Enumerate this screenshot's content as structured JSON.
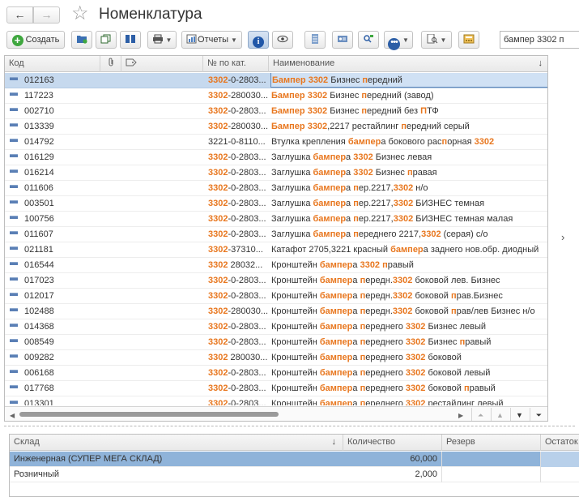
{
  "window": {
    "title": "Номенклатура",
    "nav_back": "←",
    "nav_forward": "→",
    "favorite_star": "☆"
  },
  "toolbar": {
    "create_label": "Создать",
    "reports_label": "Отчеты",
    "search_value": "бампер 3302 п"
  },
  "grid": {
    "headers": {
      "code": "Код",
      "cat_no": "№ по кат.",
      "name": "Наименование",
      "sort_indicator": "↓"
    },
    "highlight_color": "#e8771f",
    "rows": [
      {
        "code": "012163",
        "cat": [
          "3302",
          "-0-2803..."
        ],
        "name": [
          [
            "Бампер 3302",
            true
          ],
          [
            " Бизнес ",
            false
          ],
          [
            "п",
            true
          ],
          [
            "ередний",
            false
          ]
        ],
        "selected": true
      },
      {
        "code": "117223",
        "cat": [
          "3302",
          "-280030..."
        ],
        "name": [
          [
            "Бампер 3302",
            true
          ],
          [
            " Бизнес ",
            false
          ],
          [
            "п",
            true
          ],
          [
            "ередний (завод)",
            false
          ]
        ]
      },
      {
        "code": "002710",
        "cat": [
          "3302",
          "-0-2803..."
        ],
        "name": [
          [
            "Бампер 3302",
            true
          ],
          [
            " Бизнес ",
            false
          ],
          [
            "п",
            true
          ],
          [
            "ередний без ",
            false
          ],
          [
            "П",
            true
          ],
          [
            "ТФ",
            false
          ]
        ]
      },
      {
        "code": "013339",
        "cat": [
          "3302",
          "-280030..."
        ],
        "name": [
          [
            "Бампер 3302",
            true
          ],
          [
            ",2217 рестайлинг ",
            false
          ],
          [
            "п",
            true
          ],
          [
            "ередний серый",
            false
          ]
        ]
      },
      {
        "code": "014792",
        "cat": [
          "",
          "3221-0-8110..."
        ],
        "name": [
          [
            "Втулка креп",
            false
          ],
          [
            "л",
            false
          ],
          [
            "ения ",
            false
          ],
          [
            "бампер",
            true
          ],
          [
            "а бокового рас",
            false
          ],
          [
            "п",
            true
          ],
          [
            "орная ",
            false
          ],
          [
            "3302",
            true
          ]
        ]
      },
      {
        "code": "016129",
        "cat": [
          "3302",
          "-0-2803..."
        ],
        "name": [
          [
            "Заглушка ",
            false
          ],
          [
            "бампер",
            true
          ],
          [
            "а ",
            false
          ],
          [
            "3302",
            true
          ],
          [
            " Бизнес левая",
            false
          ]
        ]
      },
      {
        "code": "016214",
        "cat": [
          "3302",
          "-0-2803..."
        ],
        "name": [
          [
            "Заглушка ",
            false
          ],
          [
            "бампер",
            true
          ],
          [
            "а ",
            false
          ],
          [
            "3302",
            true
          ],
          [
            " Бизнес ",
            false
          ],
          [
            "п",
            true
          ],
          [
            "равая",
            false
          ]
        ]
      },
      {
        "code": "011606",
        "cat": [
          "3302",
          "-0-2803..."
        ],
        "name": [
          [
            "Заглушка ",
            false
          ],
          [
            "бампер",
            true
          ],
          [
            "а ",
            false
          ],
          [
            "п",
            true
          ],
          [
            "ер.2217,",
            false
          ],
          [
            "3302",
            true
          ],
          [
            " н/о",
            false
          ]
        ]
      },
      {
        "code": "003501",
        "cat": [
          "3302",
          "-0-2803..."
        ],
        "name": [
          [
            "Заглушка ",
            false
          ],
          [
            "бампер",
            true
          ],
          [
            "а ",
            false
          ],
          [
            "п",
            true
          ],
          [
            "ер.2217,",
            false
          ],
          [
            "3302",
            true
          ],
          [
            " БИЗНЕС темная",
            false
          ]
        ]
      },
      {
        "code": "100756",
        "cat": [
          "3302",
          "-0-2803..."
        ],
        "name": [
          [
            "Заглушка ",
            false
          ],
          [
            "бампер",
            true
          ],
          [
            "а ",
            false
          ],
          [
            "п",
            true
          ],
          [
            "ер.2217,",
            false
          ],
          [
            "3302",
            true
          ],
          [
            " БИЗНЕС темная малая",
            false
          ]
        ]
      },
      {
        "code": "011607",
        "cat": [
          "3302",
          "-0-2803..."
        ],
        "name": [
          [
            "Заглушка ",
            false
          ],
          [
            "бампер",
            true
          ],
          [
            "а ",
            false
          ],
          [
            "п",
            true
          ],
          [
            "ереднего 2217,",
            false
          ],
          [
            "3302",
            true
          ],
          [
            " (серая) с/о",
            false
          ]
        ]
      },
      {
        "code": "021181",
        "cat": [
          "3302",
          "-37310..."
        ],
        "name": [
          [
            "Катафот 2705,3221 красный ",
            false
          ],
          [
            "бампер",
            true
          ],
          [
            "а заднего нов.обр. диодный",
            false
          ]
        ]
      },
      {
        "code": "016544",
        "cat": [
          "3302",
          " 28032..."
        ],
        "name": [
          [
            "Кронштейн ",
            false
          ],
          [
            "бампер",
            true
          ],
          [
            "а ",
            false
          ],
          [
            "3302",
            true
          ],
          [
            " ",
            false
          ],
          [
            "п",
            true
          ],
          [
            "равый",
            false
          ]
        ]
      },
      {
        "code": "017023",
        "cat": [
          "3302",
          "-0-2803..."
        ],
        "name": [
          [
            "Кронштейн ",
            false
          ],
          [
            "бампер",
            true
          ],
          [
            "а ",
            false
          ],
          [
            "п",
            true
          ],
          [
            "еред",
            false
          ],
          [
            "н",
            false
          ],
          [
            ".",
            false
          ],
          [
            "3302",
            true
          ],
          [
            " боковой лев. Бизнес",
            false
          ]
        ]
      },
      {
        "code": "012017",
        "cat": [
          "3302",
          "-0-2803..."
        ],
        "name": [
          [
            "Кронштейн ",
            false
          ],
          [
            "бампер",
            true
          ],
          [
            "а ",
            false
          ],
          [
            "п",
            true
          ],
          [
            "еред",
            false
          ],
          [
            "н",
            false
          ],
          [
            ".",
            false
          ],
          [
            "3302",
            true
          ],
          [
            " боковой ",
            false
          ],
          [
            "п",
            true
          ],
          [
            "рав.Бизнес",
            false
          ]
        ]
      },
      {
        "code": "102488",
        "cat": [
          "3302",
          "-280030..."
        ],
        "name": [
          [
            "Кронштейн ",
            false
          ],
          [
            "бампер",
            true
          ],
          [
            "а ",
            false
          ],
          [
            "п",
            true
          ],
          [
            "еред",
            false
          ],
          [
            "н",
            false
          ],
          [
            ".",
            false
          ],
          [
            "3302",
            true
          ],
          [
            " боковой ",
            false
          ],
          [
            "п",
            true
          ],
          [
            "рав/лев Бизнес н/о",
            false
          ]
        ]
      },
      {
        "code": "014368",
        "cat": [
          "3302",
          "-0-2803..."
        ],
        "name": [
          [
            "Кронштейн ",
            false
          ],
          [
            "бампер",
            true
          ],
          [
            "а ",
            false
          ],
          [
            "п",
            true
          ],
          [
            "ереднего ",
            false
          ],
          [
            "3302",
            true
          ],
          [
            " Бизнес левый",
            false
          ]
        ]
      },
      {
        "code": "008549",
        "cat": [
          "3302",
          "-0-2803..."
        ],
        "name": [
          [
            "Кронштейн ",
            false
          ],
          [
            "бампер",
            true
          ],
          [
            "а ",
            false
          ],
          [
            "п",
            true
          ],
          [
            "ереднего ",
            false
          ],
          [
            "3302",
            true
          ],
          [
            " Бизнес ",
            false
          ],
          [
            "п",
            true
          ],
          [
            "равый",
            false
          ]
        ]
      },
      {
        "code": "009282",
        "cat": [
          "3302",
          " 280030..."
        ],
        "name": [
          [
            "Кронштейн ",
            false
          ],
          [
            "бампер",
            true
          ],
          [
            "а ",
            false
          ],
          [
            "п",
            true
          ],
          [
            "ереднего ",
            false
          ],
          [
            "3302",
            true
          ],
          [
            " боковой",
            false
          ]
        ]
      },
      {
        "code": "006168",
        "cat": [
          "3302",
          "-0-2803..."
        ],
        "name": [
          [
            "Кронштейн ",
            false
          ],
          [
            "бампер",
            true
          ],
          [
            "а ",
            false
          ],
          [
            "п",
            true
          ],
          [
            "ереднего ",
            false
          ],
          [
            "3302",
            true
          ],
          [
            " боковой левый",
            false
          ]
        ]
      },
      {
        "code": "017768",
        "cat": [
          "3302",
          "-0-2803..."
        ],
        "name": [
          [
            "Кронштейн ",
            false
          ],
          [
            "бампер",
            true
          ],
          [
            "а ",
            false
          ],
          [
            "п",
            true
          ],
          [
            "ереднего ",
            false
          ],
          [
            "3302",
            true
          ],
          [
            " боковой ",
            false
          ],
          [
            "п",
            true
          ],
          [
            "равый",
            false
          ]
        ]
      },
      {
        "code": "013301",
        "cat": [
          "3302",
          "-0-2803..."
        ],
        "name": [
          [
            "Кронштейн ",
            false
          ],
          [
            "бампер",
            true
          ],
          [
            "а ",
            false
          ],
          [
            "п",
            true
          ],
          [
            "ереднего ",
            false
          ],
          [
            "3302",
            true
          ],
          [
            " рестайлинг левый",
            false
          ]
        ]
      }
    ]
  },
  "stock": {
    "headers": {
      "warehouse": "Склад",
      "sort_indicator": "↓",
      "quantity": "Количество",
      "reserve": "Резерв",
      "remainder": "Остаток"
    },
    "rows": [
      {
        "warehouse": "Инженерная (СУПЕР МЕГА СКЛАД)",
        "quantity": "60,000",
        "reserve": "",
        "remainder": "",
        "selected": true
      },
      {
        "warehouse": "Розничный",
        "quantity": "2,000",
        "reserve": "",
        "remainder": ""
      }
    ]
  }
}
